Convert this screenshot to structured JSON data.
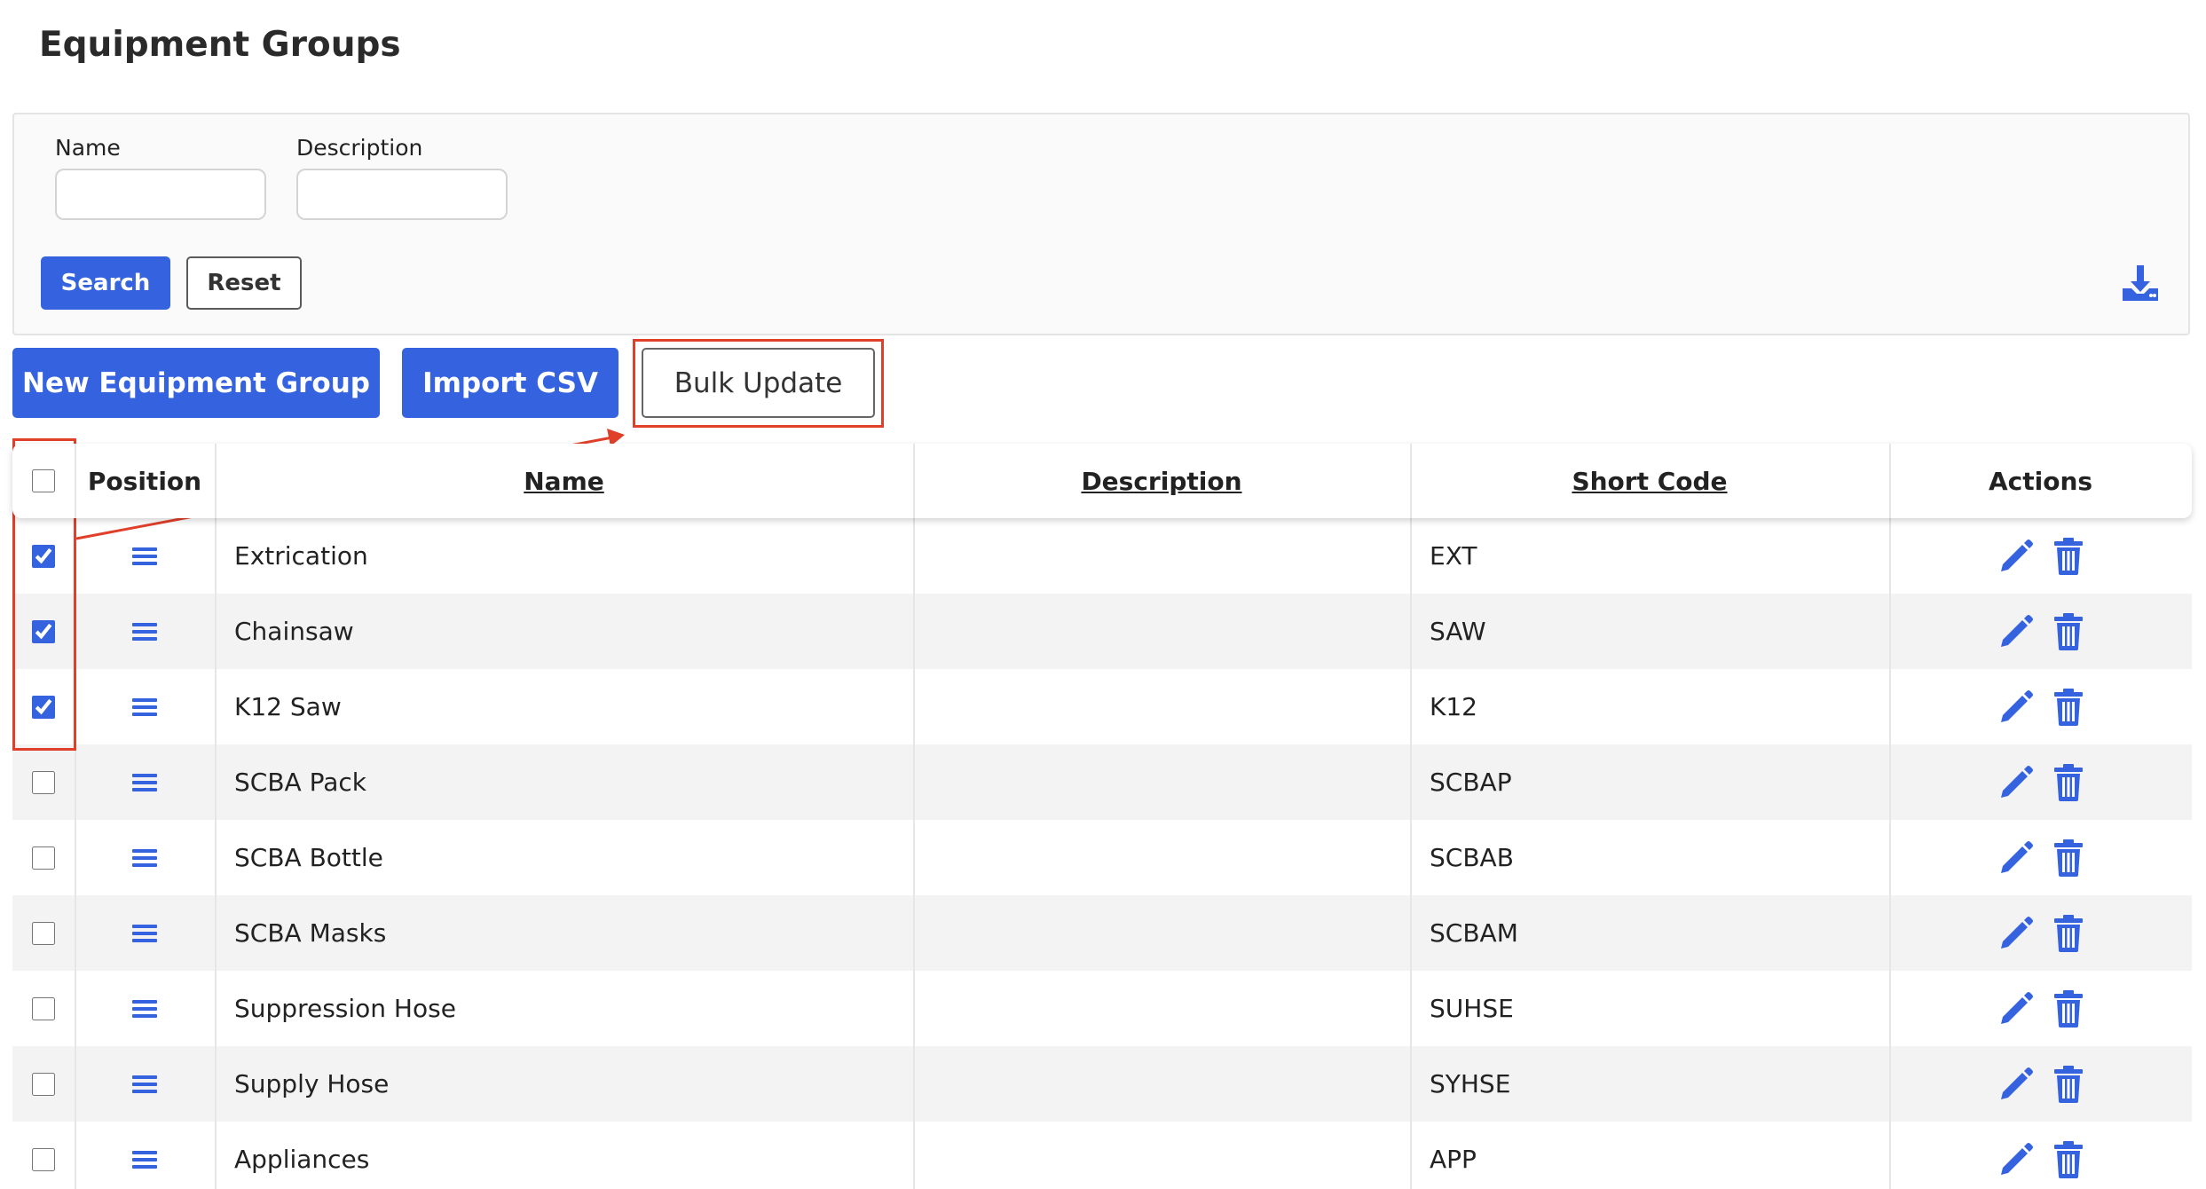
{
  "page": {
    "title": "Equipment Groups"
  },
  "filters": {
    "name_label": "Name",
    "name_value": "",
    "description_label": "Description",
    "description_value": "",
    "search_label": "Search",
    "reset_label": "Reset",
    "download_icon": "download-icon"
  },
  "toolbar": {
    "new_label": "New Equipment Group",
    "import_label": "Import CSV",
    "bulk_label": "Bulk Update"
  },
  "table": {
    "headers": {
      "position": "Position",
      "name": "Name",
      "description": "Description",
      "short_code": "Short Code",
      "actions": "Actions"
    },
    "select_all_checked": false,
    "rows": [
      {
        "checked": true,
        "name": "Extrication",
        "description": "",
        "short_code": "EXT"
      },
      {
        "checked": true,
        "name": "Chainsaw",
        "description": "",
        "short_code": "SAW"
      },
      {
        "checked": true,
        "name": "K12 Saw",
        "description": "",
        "short_code": "K12"
      },
      {
        "checked": false,
        "name": "SCBA Pack",
        "description": "",
        "short_code": "SCBAP"
      },
      {
        "checked": false,
        "name": "SCBA Bottle",
        "description": "",
        "short_code": "SCBAB"
      },
      {
        "checked": false,
        "name": "SCBA Masks",
        "description": "",
        "short_code": "SCBAM"
      },
      {
        "checked": false,
        "name": "Suppression Hose",
        "description": "",
        "short_code": "SUHSE"
      },
      {
        "checked": false,
        "name": "Supply Hose",
        "description": "",
        "short_code": "SYHSE"
      },
      {
        "checked": false,
        "name": "Appliances",
        "description": "",
        "short_code": "APP"
      }
    ]
  },
  "colors": {
    "primary": "#3563e0",
    "annotation": "#e0402a",
    "row_alt": "#f3f3f3"
  }
}
